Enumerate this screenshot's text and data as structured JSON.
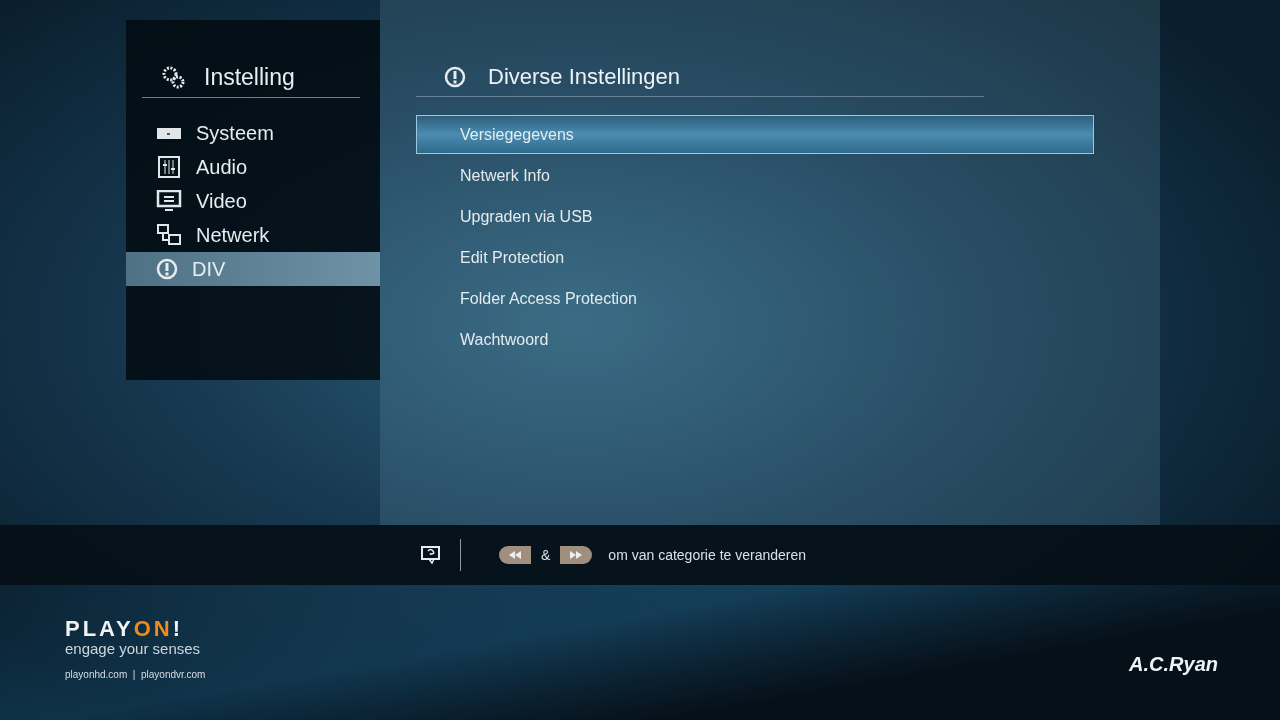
{
  "sidebar": {
    "title": "Instelling",
    "items": [
      {
        "kind": "system",
        "label": "Systeem",
        "selected": false
      },
      {
        "kind": "audio",
        "label": "Audio",
        "selected": false
      },
      {
        "kind": "video",
        "label": "Video",
        "selected": false
      },
      {
        "kind": "network",
        "label": "Netwerk",
        "selected": false
      },
      {
        "kind": "info",
        "label": "DIV",
        "selected": true
      }
    ]
  },
  "panel": {
    "title": "Diverse Instellingen",
    "items": [
      {
        "label": "Versiegegevens",
        "selected": true
      },
      {
        "label": "Netwerk Info",
        "selected": false
      },
      {
        "label": "Upgraden via USB",
        "selected": false
      },
      {
        "label": "Edit Protection",
        "selected": false
      },
      {
        "label": "Folder Access Protection",
        "selected": false
      },
      {
        "label": "Wachtwoord",
        "selected": false
      }
    ]
  },
  "hint_bar": {
    "joiner": "&",
    "text": "om van categorie te veranderen"
  },
  "footer": {
    "logo": [
      "PLAY",
      "ON",
      "!"
    ],
    "tagline": "engage your senses",
    "links": "playonhd.com  |  playondvr.com",
    "brand": "A.C.Ryan"
  }
}
